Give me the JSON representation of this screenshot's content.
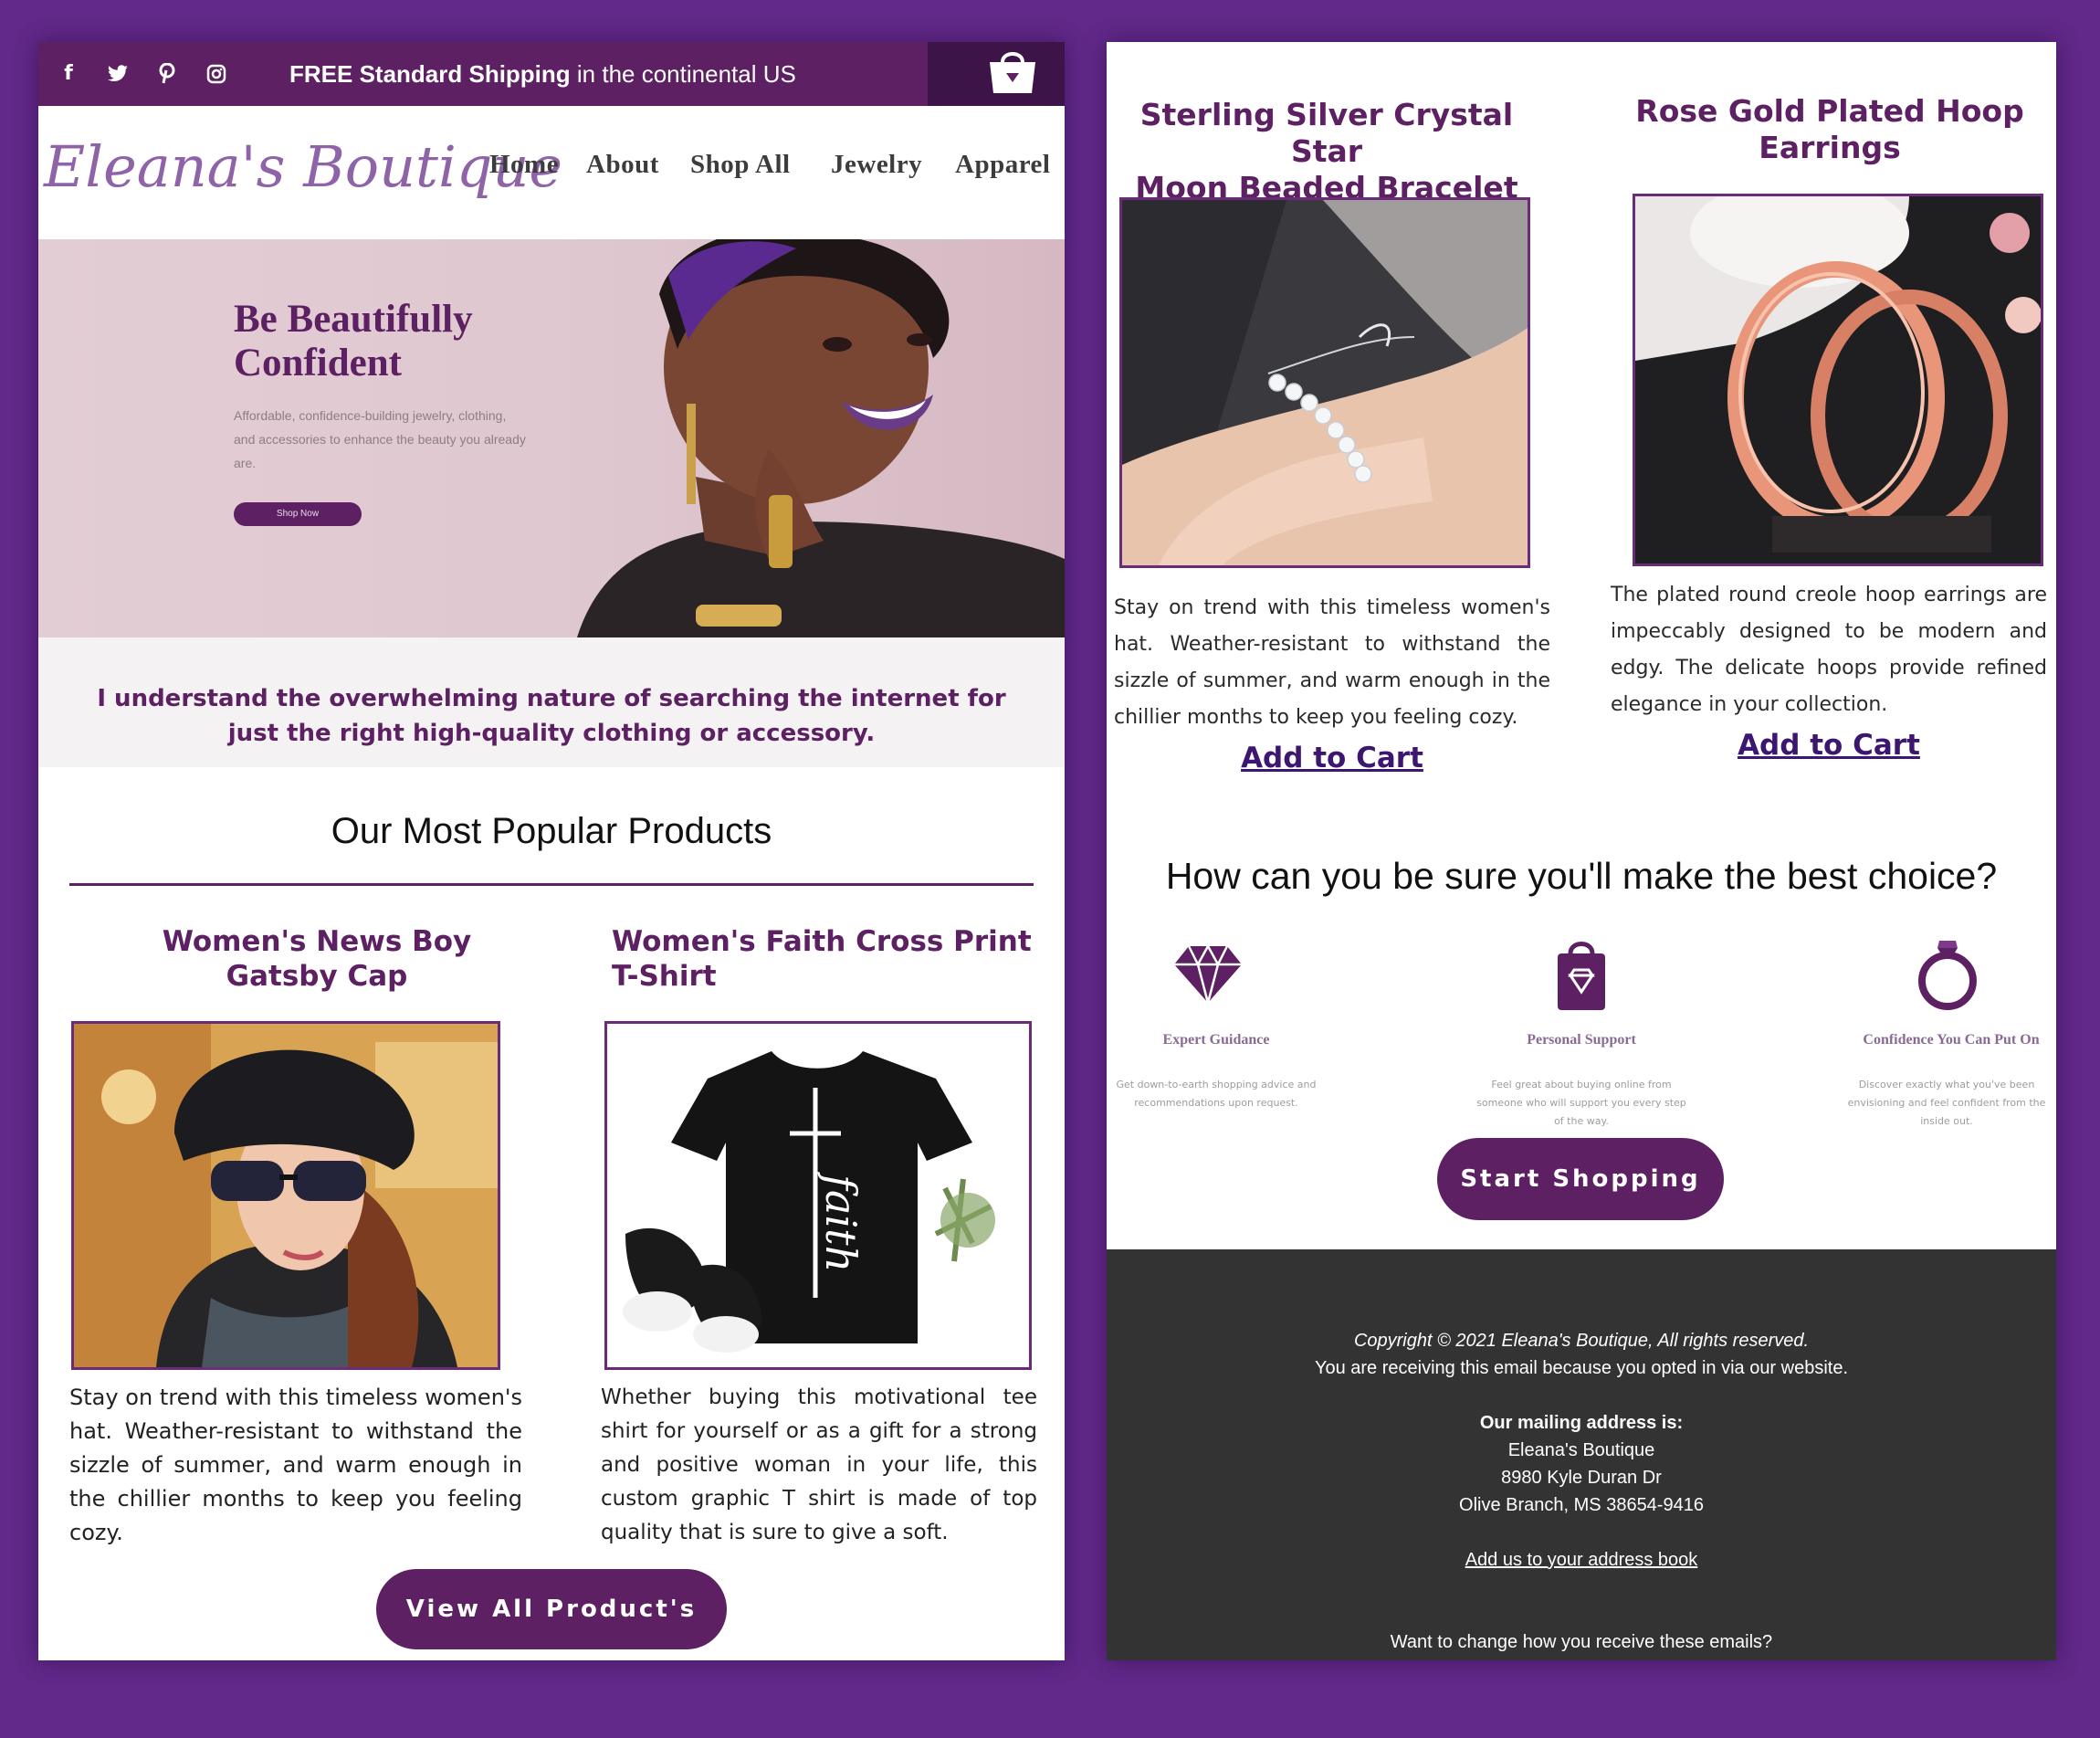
{
  "colors": {
    "background": "#62288a",
    "brand_purple": "#5c2063",
    "footer_bg": "#333333"
  },
  "topbar": {
    "social_icons": [
      "facebook-icon",
      "twitter-icon",
      "pinterest-icon",
      "instagram-icon"
    ],
    "shipping_bold": "FREE Standard Shipping",
    "shipping_rest": " in the continental US"
  },
  "header": {
    "logo": "Eleana's Boutique",
    "nav": [
      "Home",
      "About",
      "Shop All",
      "Jewelry",
      "Apparel"
    ]
  },
  "hero": {
    "title_line1": "Be Beautifully",
    "title_line2": "Confident",
    "subtitle": "Affordable, confidence-building jewelry, clothing, and accessories to enhance the beauty you already are.",
    "button": "Shop Now"
  },
  "intro_quote": "I understand the overwhelming nature of searching the internet for just the right high-quality clothing or accessory.",
  "popular": {
    "heading": "Our Most Popular Products",
    "products": [
      {
        "title_line1": "Women's News Boy",
        "title_line2": "Gatsby Cap",
        "description": "Stay on trend with this timeless women's hat. Weather-resistant to withstand the sizzle of summer, and warm enough in the chillier months to keep you feeling cozy."
      },
      {
        "title_line1": "Women's Faith Cross Print",
        "title_line2": "T-Shirt",
        "description": "Whether buying this motivational tee shirt for yourself or as a gift for a strong and positive woman in your life, this custom graphic T shirt is made of top quality that is sure to give a soft.",
        "shirt_text": "faith"
      }
    ],
    "view_all_button": "View All Product's"
  },
  "right_products": [
    {
      "title_line1": "Sterling Silver Crystal Star",
      "title_line2": "Moon Beaded Bracelet",
      "description": "Stay on trend with this timeless women's hat. Weather-resistant to withstand the sizzle of summer, and warm enough in the chillier months to keep you feeling cozy.",
      "cta": "Add to Cart"
    },
    {
      "title_line1": "Rose Gold Plated Hoop",
      "title_line2": "Earrings",
      "description": "The plated round creole hoop earrings are impeccably designed to be modern and edgy. The delicate hoops provide refined elegance in your collection.",
      "cta": "Add to Cart"
    }
  ],
  "trust": {
    "heading": "How can you be sure you'll make the best choice?",
    "features": [
      {
        "icon": "diamond-icon",
        "title": "Expert Guidance",
        "description": "Get down-to-earth shopping advice and recommendations upon request."
      },
      {
        "icon": "shopping-bag-icon",
        "title": "Personal Support",
        "description": "Feel great about buying online from someone who will support you every step of the way."
      },
      {
        "icon": "ring-icon",
        "title": "Confidence You Can Put On",
        "description": "Discover exactly what you've been envisioning and feel confident from the inside out."
      }
    ],
    "button": "Start Shopping"
  },
  "footer": {
    "copyright": "Copyright © 2021 Eleana's Boutique, All rights reserved.",
    "opted_in": "You are receiving this email because you opted in via our website.",
    "mailing_heading": "Our mailing address is:",
    "address_name": "Eleana's Boutique",
    "address_street": "8980 Kyle Duran Dr",
    "address_city": "Olive Branch, MS 38654-9416",
    "address_book_link": "Add us to your address book",
    "change_prefs": "Want to change how you receive these emails?"
  }
}
